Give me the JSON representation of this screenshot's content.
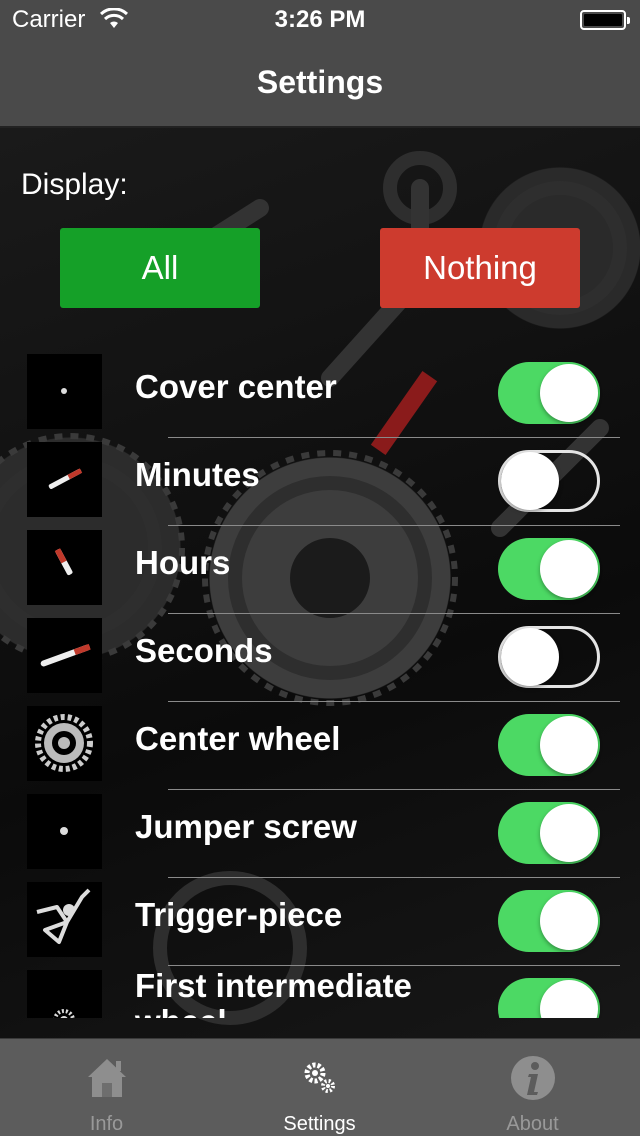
{
  "status_bar": {
    "carrier": "Carrier",
    "time": "3:26 PM"
  },
  "nav": {
    "title": "Settings"
  },
  "display": {
    "label": "Display:",
    "all_label": "All",
    "nothing_label": "Nothing"
  },
  "colors": {
    "accent_green": "#15a028",
    "accent_red": "#cd3b2e",
    "switch_on": "#4cd964"
  },
  "items": [
    {
      "label": "Cover center",
      "on": true
    },
    {
      "label": "Minutes",
      "on": false
    },
    {
      "label": "Hours",
      "on": true
    },
    {
      "label": "Seconds",
      "on": false
    },
    {
      "label": "Center wheel",
      "on": true
    },
    {
      "label": "Jumper screw",
      "on": true
    },
    {
      "label": "Trigger-piece",
      "on": true
    },
    {
      "label": "First intermediate wheel",
      "on": true
    }
  ],
  "tabs": [
    {
      "label": "Info",
      "icon": "house-icon",
      "active": false
    },
    {
      "label": "Settings",
      "icon": "gears-icon",
      "active": true
    },
    {
      "label": "About",
      "icon": "info-icon",
      "active": false
    }
  ]
}
